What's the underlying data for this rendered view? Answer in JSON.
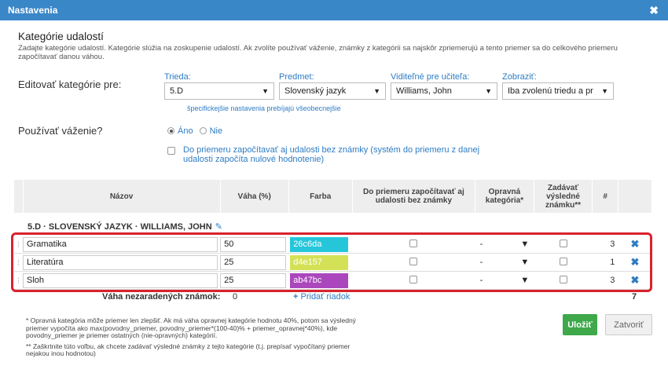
{
  "dialog": {
    "title": "Nastavenia",
    "close_glyph": "✖"
  },
  "section": {
    "title": "Kategórie udalostí",
    "description": "Zadajte kategórie udalostí. Kategórie slúžia na zoskupenie udalostí. Ak zvolíte používať váženie, známky z kategórii sa najskôr zpriemerujú a tento priemer sa do celkového priemeru započítavať danou váhou."
  },
  "edit": {
    "label": "Editovať kategórie pre:",
    "class_label": "Trieda:",
    "class_value": "5.D",
    "subject_label": "Predmet:",
    "subject_value": "Slovenský jazyk",
    "visible_label": "Viditeľné pre učiteľa:",
    "visible_value": "Williams, John",
    "show_label": "Zobraziť:",
    "show_value": "Iba zvolenú triedu a pr",
    "hint": "špecifickejšie nastavenia prebíjajú všeobecnejšie"
  },
  "weighting": {
    "label": "Používať váženie?",
    "yes": "Áno",
    "no": "Nie",
    "no_grade_text": "Do priemeru započítavať aj udalosti bez známky (systém do priemeru z danej udalosti započíta nulové hodnotenie)"
  },
  "table": {
    "headers": {
      "name": "Názov",
      "weight": "Váha (%)",
      "color": "Farba",
      "include": "Do priemeru započítavať aj udalosti bez známky",
      "remedial": "Opravná kategória*",
      "final": "Zadávať výsledné známku**",
      "count": "#"
    },
    "group": "5.D · SLOVENSKÝ JAZYK · WILLIAMS, JOHN",
    "rows": [
      {
        "name": "Gramatika",
        "weight": "50",
        "color": "26c6da",
        "remedial": "-",
        "count": "3"
      },
      {
        "name": "Literatúra",
        "weight": "25",
        "color": "d4e157",
        "remedial": "-",
        "count": "1"
      },
      {
        "name": "Sloh",
        "weight": "25",
        "color": "ab47bc",
        "remedial": "-",
        "count": "3"
      }
    ],
    "unassigned_label": "Váha nezaradených známok:",
    "unassigned_value": "0",
    "add_row": "Pridať riadok",
    "total": "7"
  },
  "notes": {
    "one": "* Opravná kategória môže priemer len zlepšiť. Ak má váha opravnej kategórie hodnotu 40%, potom sa výsledný priemer vypočíta ako max(povodny_priemer, povodny_priemer*(100-40)% + priemer_opravnej*40%), kde povodny_priemer je priemer ostatných (nie-opravných) kategórií.",
    "two": "** Zaškrtnite túto voľbu, ak chcete zadávať výsledné známky z tejto kategórie (t.j. prepísať vypočítaný priemer nejakou inou hodnotou)"
  },
  "buttons": {
    "save": "Uložiť",
    "close": "Zatvoriť"
  },
  "colors": {
    "accent": "#3a87c8",
    "save": "#3ea84a",
    "highlight": "#d9232d"
  }
}
